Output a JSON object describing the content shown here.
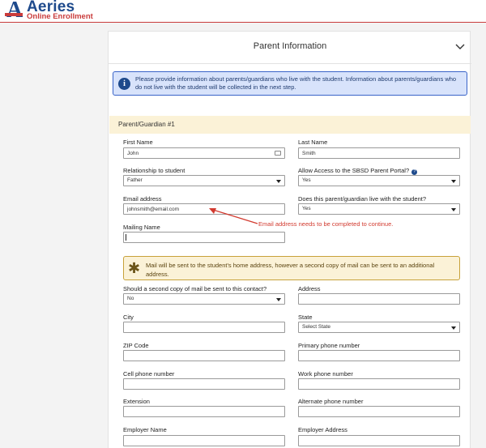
{
  "brand": {
    "mark": "A",
    "title": "Aeries",
    "subtitle": "Online Enrollment"
  },
  "panel": {
    "title": "Parent Information"
  },
  "info": {
    "icon": "info-icon",
    "text": "Please provide information about parents/guardians who live with the student. Information about parents/guardians who do not live with the student will be collected in the next step."
  },
  "section": {
    "title": "Parent/Guardian #1"
  },
  "form": {
    "first_name": {
      "label": "First Name",
      "value": "John"
    },
    "last_name": {
      "label": "Last Name",
      "value": "Smith"
    },
    "relationship": {
      "label": "Relationship to student",
      "value": "Father"
    },
    "portal_access": {
      "label": "Allow Access to the SBSD Parent Portal?",
      "value": "Yes"
    },
    "email": {
      "label": "Email address",
      "value": "johnsmith@email.com"
    },
    "lives_with": {
      "label": "Does this parent/guardian live with the student?",
      "value": "Yes"
    },
    "mailing_name": {
      "label": "Mailing Name",
      "value": ""
    },
    "second_copy": {
      "label": "Should a second copy of mail be sent to this contact?",
      "value": "No"
    },
    "address": {
      "label": "Address",
      "value": ""
    },
    "city": {
      "label": "City",
      "value": ""
    },
    "state": {
      "label": "State",
      "value": "Select State"
    },
    "zip": {
      "label": "ZIP Code",
      "value": ""
    },
    "primary_phone": {
      "label": "Primary phone number",
      "value": ""
    },
    "cell_phone": {
      "label": "Cell phone number",
      "value": ""
    },
    "work_phone": {
      "label": "Work phone number",
      "value": ""
    },
    "extension": {
      "label": "Extension",
      "value": ""
    },
    "alt_phone": {
      "label": "Alternate phone number",
      "value": ""
    },
    "employer_name": {
      "label": "Employer Name",
      "value": ""
    },
    "employer_address": {
      "label": "Employer Address",
      "value": ""
    }
  },
  "annotation": {
    "text": "Email address needs to be completed to continue.",
    "color": "#d23a2f"
  },
  "mail_notice": {
    "icon": "asterisk-icon",
    "text": "Mail will be sent to the student's home address, however a second copy of mail can be sent to an additional address."
  },
  "colors": {
    "brand_blue": "#1e4a8c",
    "brand_red": "#c93b3b",
    "info_bg": "#d8e3fb",
    "notice_bg": "#fbf2d7"
  }
}
